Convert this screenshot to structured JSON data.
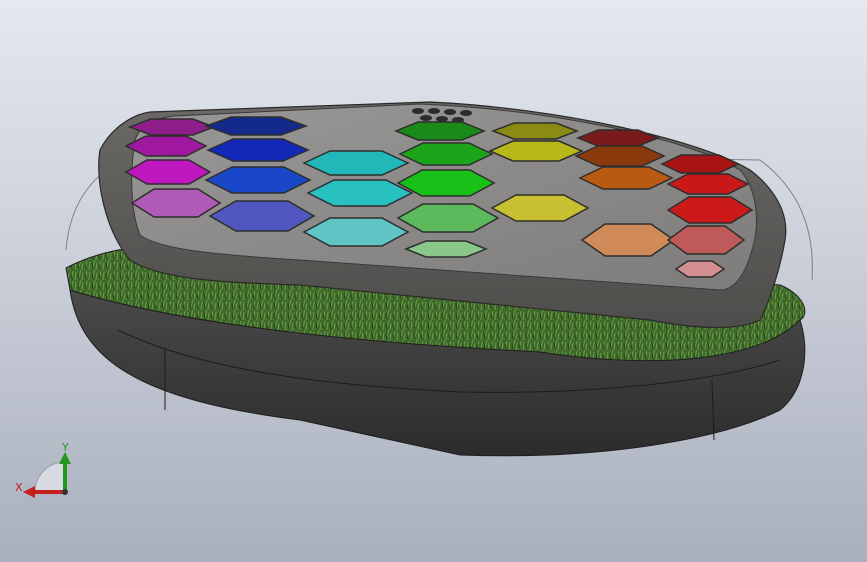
{
  "viewport": {
    "background_top": "#e4e8ef",
    "background_bottom": "#a9afbd"
  },
  "model": {
    "top_plate_color": "#8f8d8b",
    "rim_color": "#5e5c5a",
    "base_color": "#3d3d3d",
    "grass_color": "#3f6b2a",
    "cell_colors": [
      "#8e1f8a",
      "#132a8a",
      "#1a8a1a",
      "#8a8a14",
      "#7a1a1a",
      "#a018a0",
      "#1128b8",
      "#20b8b8",
      "#1aa41a",
      "#b8b818",
      "#8a3a0a",
      "#a81414",
      "#c018c0",
      "#1a46c8",
      "#28c0c0",
      "#18c018",
      "#c8c030",
      "#b85a12",
      "#c81818",
      "#b05ab8",
      "#5058c0",
      "#60c4c4",
      "#5cba5c",
      "#c8c460",
      "#d08a58",
      "#cc1a1a",
      "#8ac4c4",
      "#8ac88a",
      "#c05a5a",
      "#d49090"
    ]
  },
  "triad": {
    "x_label": "X",
    "y_label": "Y",
    "x_color": "#c42020",
    "y_color": "#1f9a1f"
  }
}
